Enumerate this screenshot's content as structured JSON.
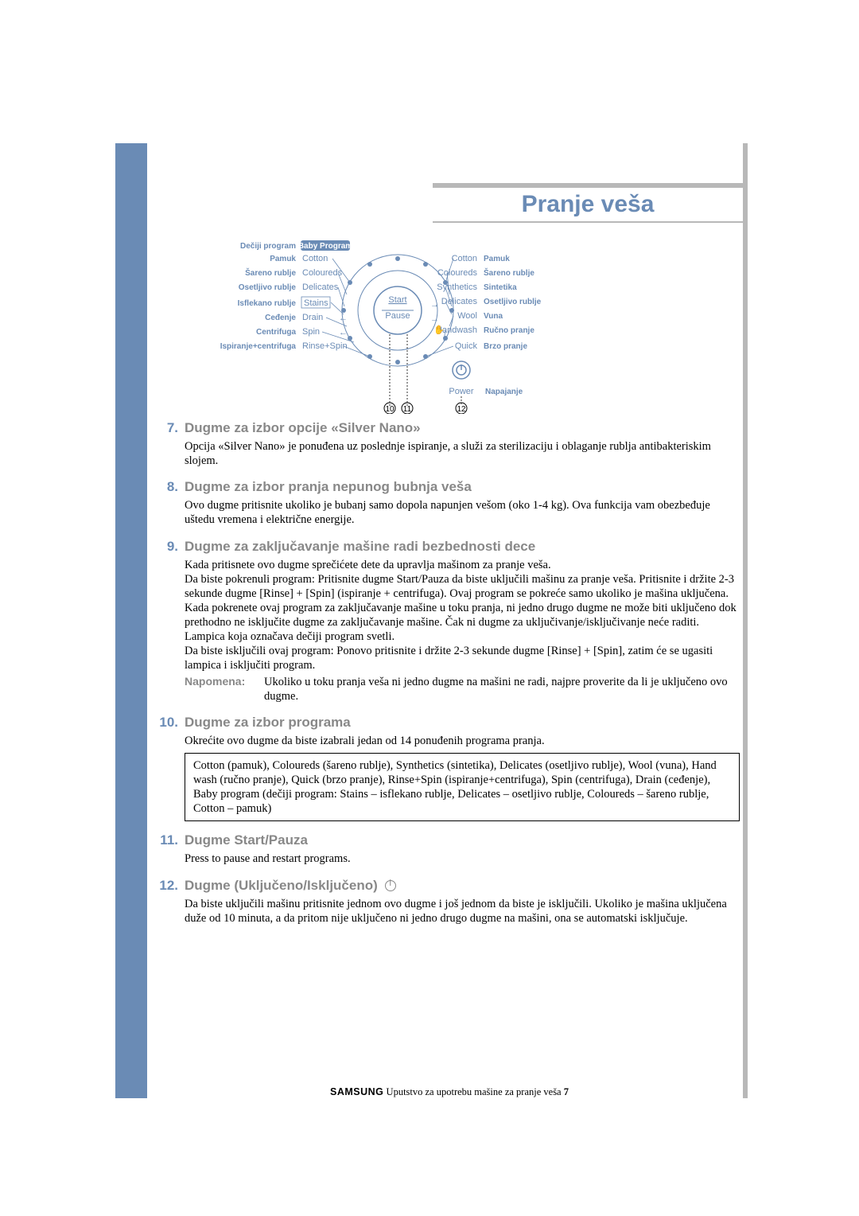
{
  "header": {
    "title": "Pranje veša"
  },
  "dial": {
    "left": [
      {
        "sr": "Dečiji program",
        "en": "Baby Program"
      },
      {
        "sr": "Pamuk",
        "en": "Cotton"
      },
      {
        "sr": "Šareno rublje",
        "en": "Coloureds"
      },
      {
        "sr": "Osetljivo rublje",
        "en": "Delicates"
      },
      {
        "sr": "Isflekano rublje",
        "en": "Stains"
      },
      {
        "sr": "Ceđenje",
        "en": "Drain"
      },
      {
        "sr": "Centrifuga",
        "en": "Spin"
      },
      {
        "sr": "Ispiranje+centrifuga",
        "en": "Rinse+Spin"
      }
    ],
    "right": [
      {
        "sr": "Pamuk",
        "en": "Cotton"
      },
      {
        "sr": "Šareno rublje",
        "en": "Coloureds"
      },
      {
        "sr": "Sintetika",
        "en": "Synthetics"
      },
      {
        "sr": "Osetljivo rublje",
        "en": "Delicates"
      },
      {
        "sr": "Vuna",
        "en": "Wool"
      },
      {
        "sr": "Ručno pranje",
        "en": "Handwash"
      },
      {
        "sr": "Brzo pranje",
        "en": "Quick"
      }
    ],
    "center": {
      "start": "Start",
      "pause": "Pause"
    },
    "power": "Power",
    "power_sr": "Napajanje",
    "marker10": "10",
    "marker11": "11",
    "marker12": "12"
  },
  "sections": [
    {
      "num": "7.",
      "title": "Dugme za izbor opcije «Silver Nano»",
      "body": "Opcija «Silver Nano» je ponuđena uz poslednje ispiranje, a služi za sterilizaciju i oblaganje rublja antibakteriskim slojem."
    },
    {
      "num": "8.",
      "title": "Dugme za izbor pranja nepunog bubnja veša",
      "body": "Ovo dugme pritisnite ukoliko je bubanj samo dopola napunjen vešom (oko 1-4 kg). Ova funkcija vam obezbeđuje uštedu vremena i električne energije."
    },
    {
      "num": "9.",
      "title": "Dugme za zaključavanje mašine radi bezbednosti dece",
      "body": "Kada pritisnete ovo dugme sprečićete dete da upravlja mašinom za pranje veša.\nDa biste pokrenuli program: Pritisnite dugme Start/Pauza da biste uključili mašinu za pranje veša. Pritisnite i držite 2-3 sekunde dugme [Rinse] + [Spin] (ispiranje + centrifuga). Ovaj program se pokreće samo ukoliko je mašina uključena. Kada pokrenete ovaj program za zaključavanje mašine u toku pranja, ni jedno drugo dugme ne može biti uključeno dok prethodno ne isključite dugme za zaključavanje mašine. Čak ni dugme za uključivanje/isključivanje neće raditi. Lampica koja označava dečiji program svetli.\nDa biste isključili ovaj program: Ponovo pritisnite i držite 2-3 sekunde dugme [Rinse] + [Spin], zatim će se ugasiti lampica i isključiti program.",
      "note_label": "Napomena:",
      "note_text": "Ukoliko u toku pranja veša ni jedno dugme na mašini ne radi, najpre proverite da li je uključeno ovo dugme."
    },
    {
      "num": "10.",
      "title": "Dugme za izbor programa",
      "body": "Okrećite ovo dugme da biste izabrali jedan od 14 ponuđenih programa pranja.",
      "box": "Cotton (pamuk), Coloureds (šareno rublje), Synthetics (sintetika), Delicates (osetljivo rublje), Wool (vuna), Hand wash (ručno pranje), Quick (brzo pranje), Rinse+Spin (ispiranje+centrifuga), Spin (centrifuga), Drain (ceđenje), Baby program (dečiji program: Stains – isflekano rublje, Delicates – osetljivo rublje, Coloureds – šareno rublje, Cotton – pamuk)"
    },
    {
      "num": "11.",
      "title": "Dugme Start/Pauza",
      "body": "Press to pause and restart programs."
    },
    {
      "num": "12.",
      "title": "Dugme (Uključeno/Isključeno)",
      "has_power_icon": true,
      "body": "Da biste uključili mašinu pritisnite jednom ovo dugme i još jednom da biste je isključili. Ukoliko je mašina uključena duže od 10 minuta, a da pritom nije uključeno ni jedno drugo dugme na mašini, ona se automatski isključuje."
    }
  ],
  "footer": {
    "brand": "SAMSUNG",
    "text": "Uputstvo za upotrebu mašine za pranje veša",
    "page": "7"
  }
}
